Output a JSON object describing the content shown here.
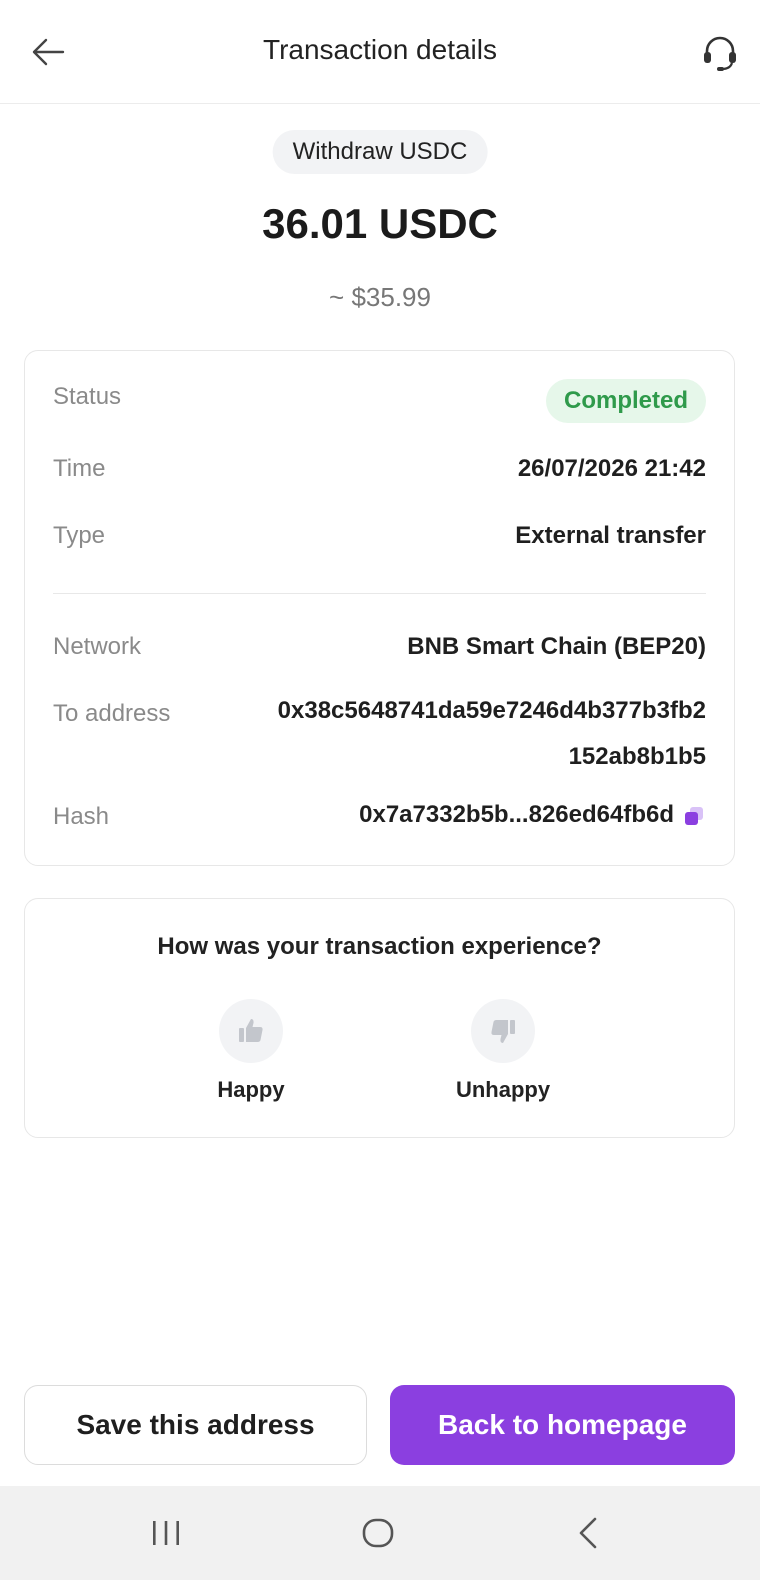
{
  "header": {
    "title": "Transaction details",
    "back_icon": "arrow-left-icon",
    "support_icon": "headset-icon"
  },
  "summary": {
    "type": "Withdraw USDC",
    "amount": "36.01 USDC",
    "fiat": "~ $35.99"
  },
  "details": {
    "status_label": "Status",
    "status_value": "Completed",
    "time_label": "Time",
    "time_value": "26/07/2026 21:42",
    "type_label": "Type",
    "type_value": "External transfer",
    "network_label": "Network",
    "network_value": "BNB Smart Chain (BEP20)",
    "address_label": "To address",
    "address_line1": "0x38c5648741da59e7246d4b377b3fb2",
    "address_line2": "152ab8b1b5",
    "hash_label": "Hash",
    "hash_value": "0x7a7332b5b...826ed64fb6d",
    "copy_icon": "copy-icon"
  },
  "feedback": {
    "question": "How was your transaction experience?",
    "happy_label": "Happy",
    "unhappy_label": "Unhappy"
  },
  "actions": {
    "save_label": "Save this address",
    "home_label": "Back to homepage"
  },
  "colors": {
    "accent": "#8b3fe0",
    "status_bg": "#e6f7ea",
    "status_text": "#2f9a4b"
  }
}
